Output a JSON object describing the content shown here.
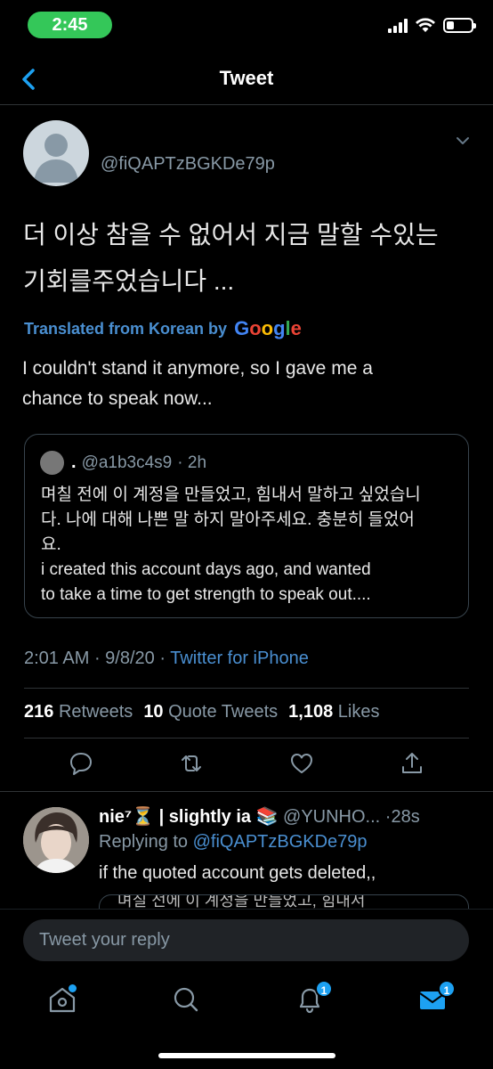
{
  "status_bar": {
    "time": "2:45",
    "time_pill_color": "#34c759"
  },
  "header": {
    "title": "Tweet",
    "back_icon": "chevron-left-icon"
  },
  "tweet": {
    "handle": "@fiQAPTzBGKDe79p",
    "text_line_1": "더 이상 참을 수 없어서 지금 말할 수있는",
    "text_line_2": "기회를주었습니다 ...",
    "translated_label": "Translated from Korean by",
    "translator": "Google",
    "translation_line_1": "I couldn't stand it anymore, so I gave me a",
    "translation_line_2": "chance to speak now..."
  },
  "quote": {
    "name": ".",
    "handle": "@a1b3c4s9",
    "time": "· 2h",
    "line_1": "며칠 전에 이 계정을 만들었고, 힘내서 말하고 싶었습니",
    "line_2": "다. 나에 대해 나쁜 말 하지 말아주세요. 충분히 들었어",
    "line_3": "요.",
    "line_4": "i created this account days ago, and wanted",
    "line_5": "to take a time to get strength to speak out...."
  },
  "meta": {
    "time": "2:01 AM",
    "date": "9/8/20",
    "source": "Twitter for iPhone"
  },
  "stats": {
    "retweets_count": "216",
    "retweets_label": "Retweets",
    "quotes_count": "10",
    "quotes_label": "Quote Tweets",
    "likes_count": "1,108",
    "likes_label": "Likes"
  },
  "reply": {
    "name": "nie⁷⏳ | slightly ia 📚",
    "handle": "@YUNHO...",
    "time": "·28s",
    "replying_label": "Replying to",
    "replying_to": "@fiQAPTzBGKDe79p",
    "text": "if the quoted account gets deleted,,",
    "quote_peek": "며칠 전에 이 계정을 만들었고, 힘내서"
  },
  "compose": {
    "placeholder": "Tweet your reply"
  },
  "tabs": {
    "notifications_badge": "1",
    "messages_badge": "1"
  },
  "colors": {
    "accent": "#1da1f2",
    "link": "#4a8fd1",
    "secondary_text": "#8899a6"
  }
}
